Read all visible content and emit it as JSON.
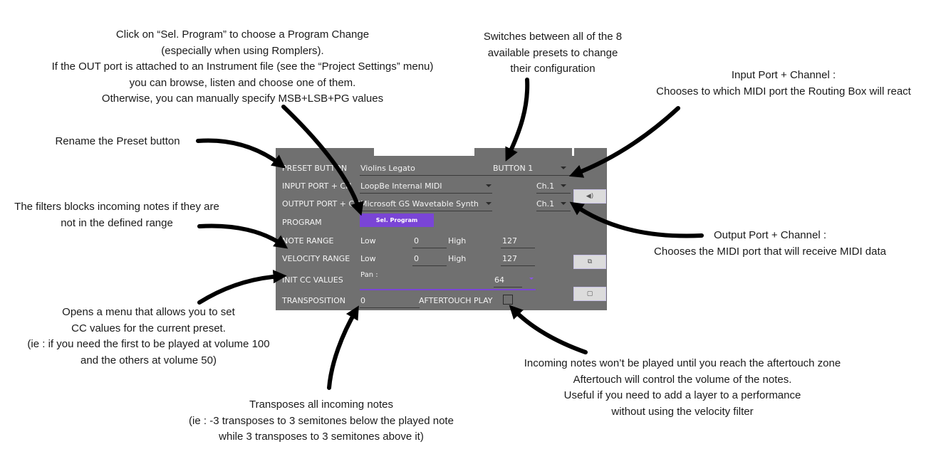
{
  "annotations": {
    "sel_program": [
      "Click on “Sel. Program” to choose a Program Change",
      "(especially when using Romplers).",
      "If the OUT port is attached to an Instrument file (see the “Project Settings” menu)",
      "you can browse, listen and choose one of them.",
      "Otherwise, you can manually specify MSB+LSB+PG values"
    ],
    "switch_presets": [
      "Switches between all of the 8",
      "available presets to change",
      "their configuration"
    ],
    "input_port": [
      "Input Port + Channel :",
      "Chooses to which MIDI port the Routing Box will react"
    ],
    "rename": [
      "Rename the Preset button"
    ],
    "filters": [
      "The filters blocks incoming notes if they are",
      "not in the defined range"
    ],
    "output_port": [
      "Output Port + Channel :",
      "Chooses the MIDI port that will receive MIDI data"
    ],
    "cc_menu": [
      "Opens a menu that allows you to set",
      "CC values for the current preset.",
      "(ie : if you need the first to be played at volume 100",
      "and the others at volume 50)"
    ],
    "aftertouch": [
      "Incoming notes won’t be played until you reach the aftertouch zone",
      "Aftertouch will control the volume of the notes.",
      "Useful if you need to add a layer to a performance",
      "without using the velocity filter"
    ],
    "transpose": [
      "Transposes all incoming notes",
      "(ie : -3 transposes to 3 semitones below the played note",
      "while 3 transposes to 3 semitones above it)"
    ]
  },
  "panel": {
    "labels": {
      "preset_button": "PRESET BUTTON",
      "input_port": "INPUT PORT + CH",
      "output_port": "OUTPUT PORT + CH",
      "program": "PROGRAM",
      "note_range": "NOTE RANGE",
      "velocity_range": "VELOCITY RANGE",
      "init_cc": "INIT CC VALUES",
      "transposition": "TRANSPOSITION"
    },
    "preset_name": "Violins Legato",
    "button_select": "BUTTON 1",
    "input_port_value": "LoopBe Internal MIDI",
    "input_channel": "Ch.1",
    "output_port_value": "Microsoft GS Wavetable Synth",
    "output_channel": "Ch.1",
    "sel_program_label": "Sel. Program",
    "note_low_label": "Low",
    "note_low_value": "0",
    "note_high_label": "High",
    "note_high_value": "127",
    "vel_low_label": "Low",
    "vel_low_value": "0",
    "vel_high_label": "High",
    "vel_high_value": "127",
    "cc_name": "Pan :",
    "cc_value": "64",
    "transposition_value": "0",
    "aftertouch_label": "AFTERTOUCH PLAY",
    "aftertouch_checked": false,
    "side_buttons": [
      {
        "icon": "speaker-icon",
        "glyph": "◀)"
      },
      {
        "icon": "copy-icon",
        "glyph": "⧉"
      },
      {
        "icon": "paste-icon",
        "glyph": "▢"
      }
    ],
    "accent_color": "#7a45d6",
    "panel_color": "#707070"
  }
}
